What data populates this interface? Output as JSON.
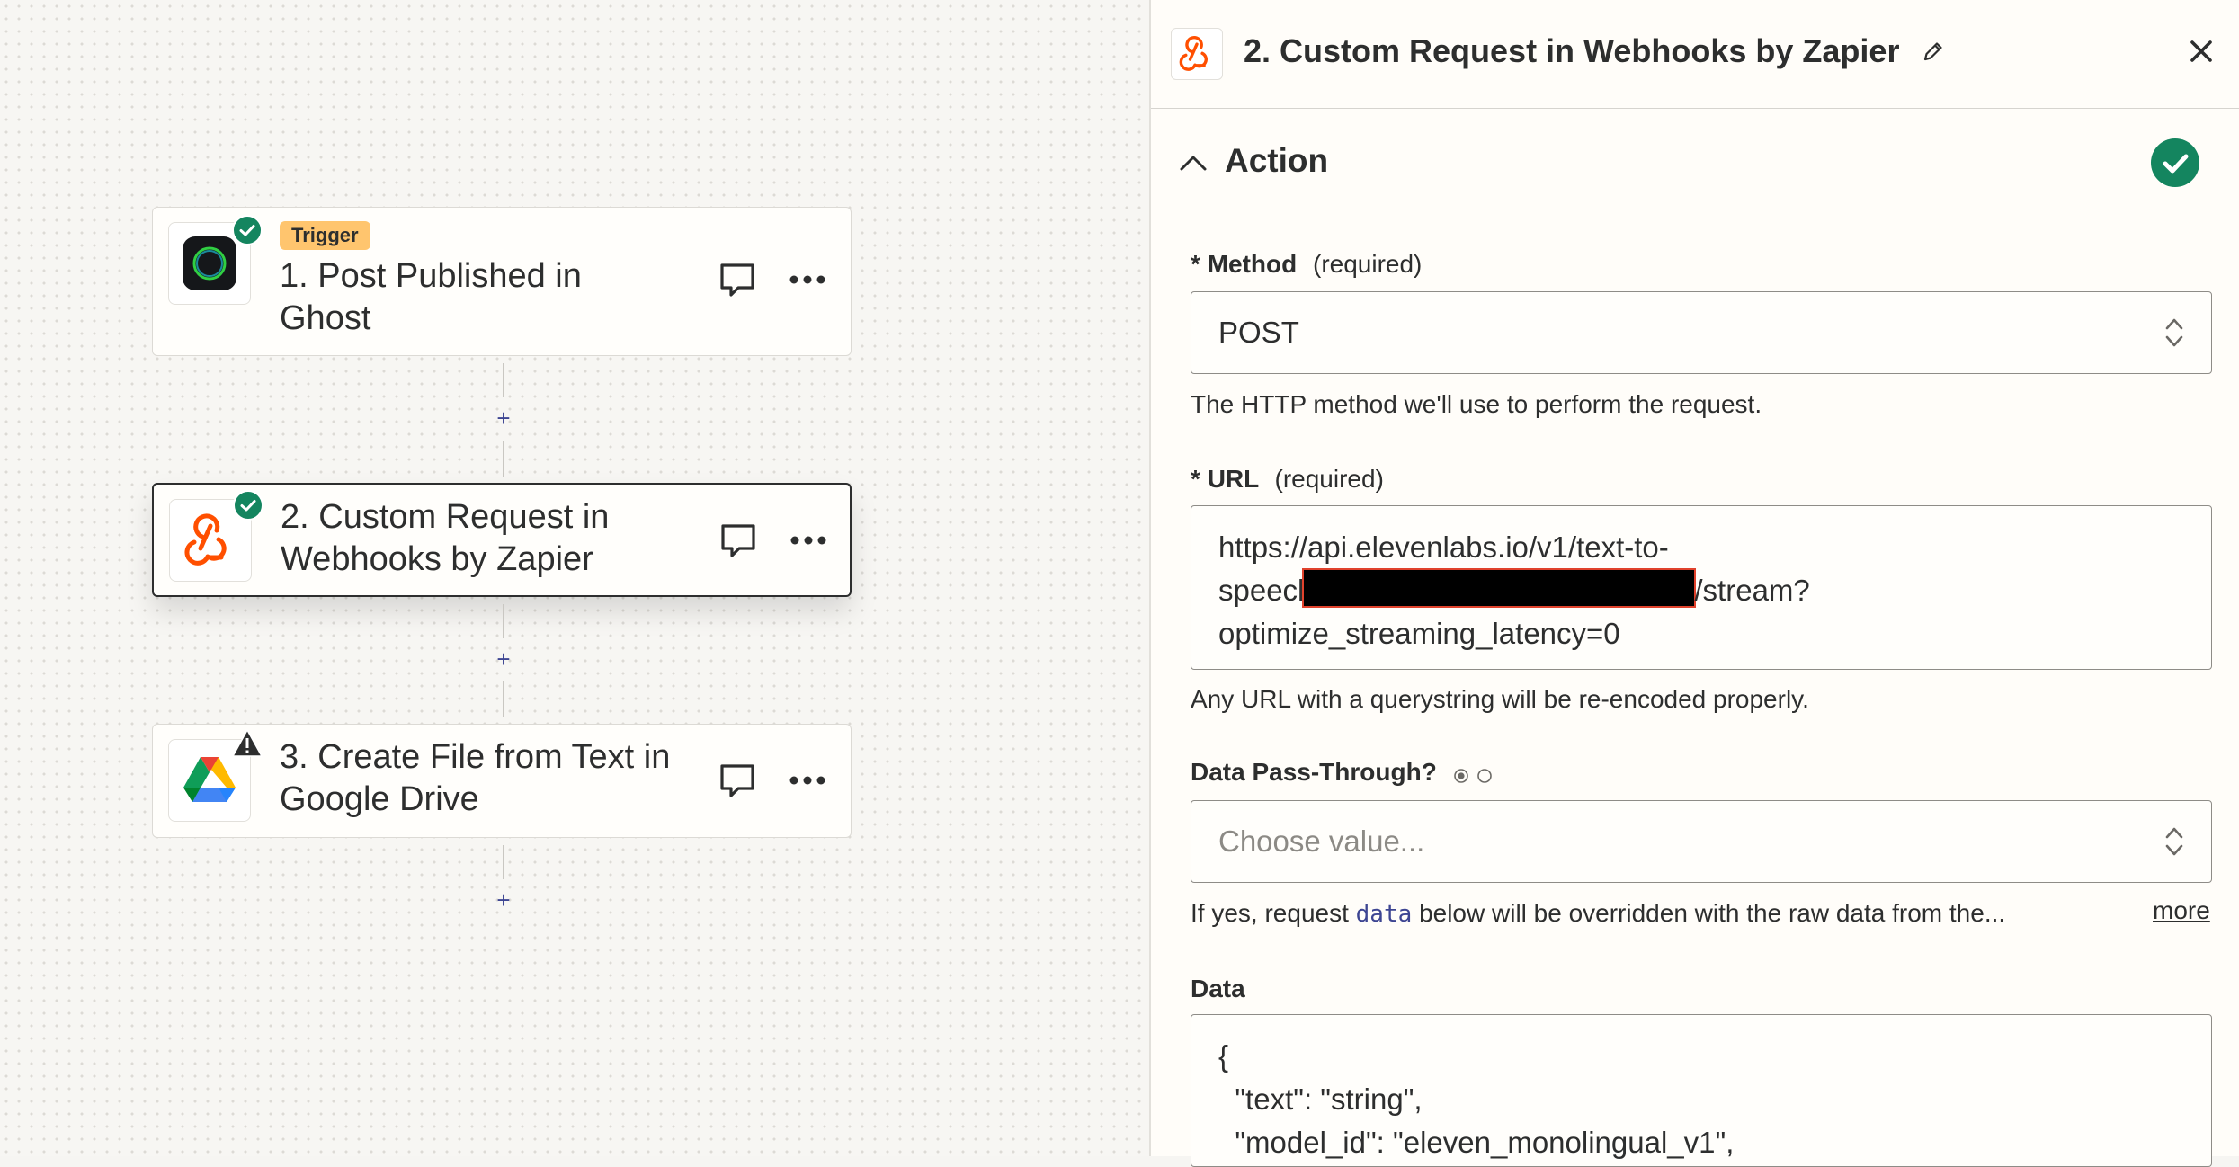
{
  "workflow": {
    "steps": [
      {
        "badge": "Trigger",
        "title": "1. Post Published in Ghost",
        "app_icon": "ghost-icon",
        "status": "complete"
      },
      {
        "badge": "",
        "title": "2. Custom Request in Webhooks by Zapier",
        "app_icon": "webhook-icon",
        "status": "complete"
      },
      {
        "badge": "",
        "title": "3. Create File from Text in Google Drive",
        "app_icon": "google-drive-icon",
        "status": "warning"
      }
    ],
    "add_step_label": "+"
  },
  "panel": {
    "title": "2. Custom Request in Webhooks by Zapier",
    "section": {
      "title": "Action",
      "status": "complete"
    },
    "fields": {
      "method": {
        "label": "Method",
        "required_marker": "*",
        "required_text": "(required)",
        "value": "POST",
        "help": "The HTTP method we'll use to perform the request."
      },
      "url": {
        "label": "URL",
        "required_marker": "*",
        "required_text": "(required)",
        "value_line1": "https://api.elevenlabs.io/v1/text-to-",
        "value_line2_prefix": "speecl",
        "value_line2_suffix": "/stream?",
        "value_line3": "optimize_streaming_latency=0",
        "help": "Any URL with a querystring will be re-encoded properly."
      },
      "data_pass_through": {
        "label": "Data Pass-Through?",
        "placeholder": "Choose value...",
        "help_prefix": "If yes, request",
        "help_code": "data",
        "help_suffix": "below will be overridden with the raw data from the...",
        "more_link": "more"
      },
      "data": {
        "label": "Data",
        "line1": "{",
        "line2": "  \"text\": \"string\",",
        "line3": "  \"model_id\": \"eleven_monolingual_v1\","
      }
    }
  },
  "colors": {
    "success_green": "#14855f",
    "webhook_orange": "#ff4f00",
    "link_blue": "#3d4592",
    "trigger_badge": "#ffc56e"
  }
}
